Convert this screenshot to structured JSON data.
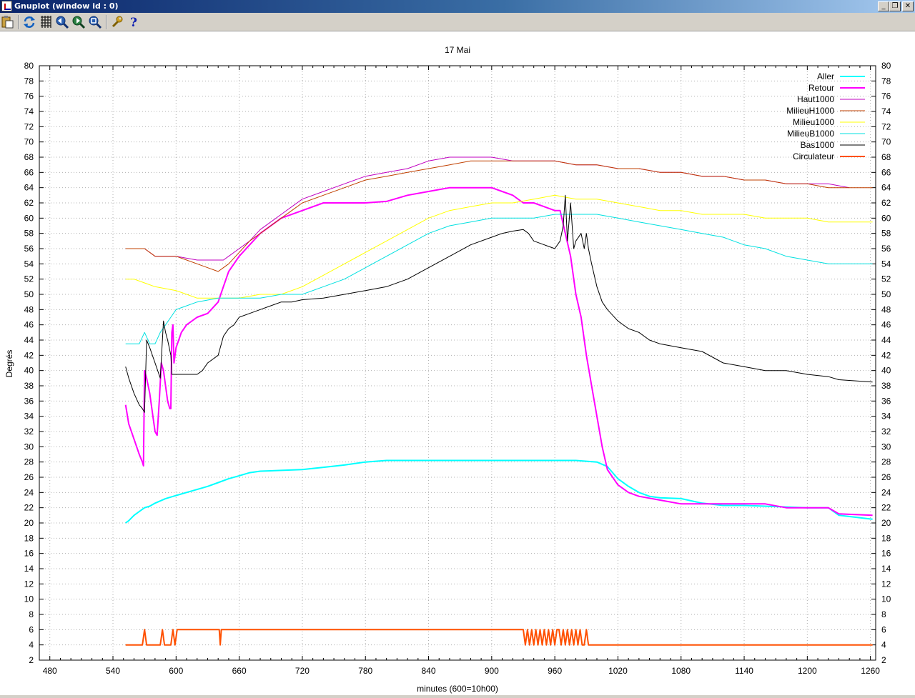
{
  "window": {
    "title": "Gnuplot (window id : 0)"
  },
  "toolbar": {
    "items": [
      "copy-to-clipboard",
      "replot",
      "toggle-grid",
      "zoom-previous",
      "zoom-next",
      "unzoom",
      "options",
      "help"
    ]
  },
  "colors": {
    "Aller": "#00ffff",
    "Retour": "#ff00ff",
    "Haut1000": "#c000c0",
    "MilieuH1000": "#c04000",
    "Milieu1000": "#ffff00",
    "MilieuB1000": "#00e0e0",
    "Bas1000": "#000000",
    "Circulateur": "#ff5000"
  },
  "chart_data": {
    "type": "line",
    "title": "17 Mai",
    "xlabel": "minutes (600=10h00)",
    "ylabel": "Degrés",
    "xlim": [
      470,
      1265
    ],
    "ylim": [
      2,
      80
    ],
    "xticks": [
      480,
      540,
      600,
      660,
      720,
      780,
      840,
      900,
      960,
      1020,
      1080,
      1140,
      1200,
      1260
    ],
    "yticks": [
      2,
      4,
      6,
      8,
      10,
      12,
      14,
      16,
      18,
      20,
      22,
      24,
      26,
      28,
      30,
      32,
      34,
      36,
      38,
      40,
      42,
      44,
      46,
      48,
      50,
      52,
      54,
      56,
      58,
      60,
      62,
      64,
      66,
      68,
      70,
      72,
      74,
      76,
      78,
      80
    ],
    "grid": true,
    "legend_position": "top-right",
    "series": [
      {
        "name": "Aller",
        "color": "#00ffff",
        "width": 2,
        "x": [
          552,
          555,
          560,
          565,
          570,
          575,
          580,
          590,
          600,
          610,
          620,
          630,
          640,
          650,
          660,
          670,
          680,
          700,
          720,
          740,
          760,
          780,
          800,
          820,
          840,
          860,
          880,
          900,
          920,
          940,
          960,
          980,
          1000,
          1010,
          1020,
          1030,
          1040,
          1050,
          1060,
          1080,
          1100,
          1120,
          1140,
          1160,
          1180,
          1200,
          1220,
          1230,
          1262
        ],
        "y": [
          20,
          20.3,
          21,
          21.5,
          22,
          22.2,
          22.6,
          23.2,
          23.6,
          24,
          24.4,
          24.8,
          25.3,
          25.8,
          26.2,
          26.6,
          26.8,
          26.9,
          27,
          27.3,
          27.6,
          28,
          28.2,
          28.2,
          28.2,
          28.2,
          28.2,
          28.2,
          28.2,
          28.2,
          28.2,
          28.2,
          28,
          27.4,
          25.8,
          24.8,
          24,
          23.5,
          23.3,
          23.2,
          22.6,
          22.3,
          22.3,
          22.2,
          22.1,
          22,
          22,
          21,
          20.5
        ]
      },
      {
        "name": "Retour",
        "color": "#ff00ff",
        "width": 2,
        "x": [
          552,
          555,
          560,
          565,
          568,
          569,
          570,
          572,
          575,
          578,
          580,
          582,
          584,
          586,
          588,
          590,
          592,
          594,
          595,
          596,
          597,
          598,
          600,
          605,
          610,
          620,
          630,
          640,
          645,
          650,
          660,
          670,
          680,
          700,
          720,
          740,
          760,
          780,
          800,
          820,
          840,
          860,
          880,
          900,
          910,
          920,
          930,
          940,
          950,
          960,
          965,
          970,
          975,
          980,
          985,
          990,
          995,
          1000,
          1005,
          1010,
          1020,
          1030,
          1040,
          1060,
          1080,
          1100,
          1120,
          1140,
          1160,
          1180,
          1200,
          1220,
          1230,
          1262
        ],
        "y": [
          35.5,
          33,
          31,
          29,
          28,
          27.5,
          40,
          39,
          37,
          34,
          32,
          31.5,
          36,
          41,
          40,
          38,
          36,
          35,
          35,
          45,
          46,
          41,
          43,
          45,
          46,
          47,
          47.5,
          49,
          51,
          53,
          55,
          56.5,
          58,
          60,
          61,
          62,
          62,
          62,
          62.2,
          63,
          63.5,
          64,
          64,
          64,
          63.5,
          63,
          62,
          62,
          61.5,
          61,
          61,
          58,
          55,
          50,
          47,
          42,
          38,
          34,
          30,
          27,
          25,
          24,
          23.5,
          23,
          22.5,
          22.5,
          22.5,
          22.5,
          22.5,
          22,
          22,
          22,
          21.2,
          21
        ]
      },
      {
        "name": "Haut1000",
        "color": "#c000c0",
        "width": 1,
        "x": [
          552,
          570,
          580,
          600,
          620,
          640,
          645,
          650,
          660,
          670,
          680,
          690,
          700,
          710,
          720,
          740,
          760,
          780,
          800,
          820,
          840,
          860,
          880,
          900,
          920,
          940,
          960,
          980,
          1000,
          1020,
          1040,
          1060,
          1080,
          1100,
          1120,
          1140,
          1160,
          1180,
          1200,
          1220,
          1240
        ],
        "y": [
          56,
          56,
          55,
          55,
          54.5,
          54.5,
          54.5,
          55,
          56,
          57,
          58.5,
          59.5,
          60.5,
          61.5,
          62.5,
          63.5,
          64.5,
          65.5,
          66,
          66.5,
          67.5,
          68,
          68,
          68,
          67.5,
          67.5,
          67.5,
          67,
          67,
          66.5,
          66.5,
          66,
          66,
          65.5,
          65.5,
          65,
          65,
          64.5,
          64.5,
          64.5,
          64
        ]
      },
      {
        "name": "MilieuH1000",
        "color": "#c04000",
        "width": 1,
        "x": [
          552,
          570,
          580,
          600,
          620,
          630,
          640,
          645,
          650,
          660,
          670,
          680,
          690,
          700,
          710,
          720,
          740,
          760,
          780,
          800,
          820,
          840,
          860,
          880,
          900,
          920,
          940,
          960,
          980,
          1000,
          1020,
          1040,
          1060,
          1080,
          1100,
          1120,
          1140,
          1160,
          1180,
          1200,
          1220,
          1262
        ],
        "y": [
          56,
          56,
          55,
          55,
          54,
          53.5,
          53,
          53.5,
          54,
          55.5,
          57,
          58,
          59,
          60,
          61,
          62,
          63,
          64,
          65,
          65.5,
          66,
          66.5,
          67,
          67.5,
          67.5,
          67.5,
          67.5,
          67.5,
          67,
          67,
          66.5,
          66.5,
          66,
          66,
          65.5,
          65.5,
          65,
          65,
          64.5,
          64.5,
          64,
          64
        ]
      },
      {
        "name": "Milieu1000",
        "color": "#ffff00",
        "width": 1,
        "x": [
          552,
          560,
          570,
          580,
          600,
          620,
          640,
          660,
          680,
          700,
          720,
          740,
          760,
          780,
          800,
          820,
          840,
          860,
          880,
          900,
          920,
          940,
          960,
          980,
          1000,
          1020,
          1040,
          1060,
          1080,
          1100,
          1120,
          1140,
          1160,
          1180,
          1200,
          1220,
          1262
        ],
        "y": [
          52,
          52,
          51.5,
          51,
          50.5,
          49.5,
          49.5,
          49.5,
          50,
          50,
          51,
          52.5,
          54,
          55.5,
          57,
          58.5,
          60,
          61,
          61.5,
          62,
          62,
          62.5,
          63,
          62.5,
          62.5,
          62,
          61.5,
          61,
          61,
          60.5,
          60.5,
          60.5,
          60,
          60,
          60,
          59.5,
          59.5
        ]
      },
      {
        "name": "MilieuB1000",
        "color": "#00e0e0",
        "width": 1,
        "x": [
          552,
          560,
          565,
          570,
          575,
          580,
          585,
          590,
          595,
          600,
          620,
          640,
          660,
          680,
          700,
          720,
          740,
          760,
          780,
          800,
          820,
          840,
          860,
          880,
          900,
          920,
          940,
          960,
          980,
          1000,
          1020,
          1040,
          1060,
          1080,
          1100,
          1120,
          1140,
          1160,
          1180,
          1200,
          1220,
          1262
        ],
        "y": [
          43.5,
          43.5,
          43.5,
          45,
          43.5,
          43.5,
          45,
          46,
          47,
          48,
          49,
          49.5,
          49.5,
          49.5,
          50,
          50,
          51,
          52,
          53.5,
          55,
          56.5,
          58,
          59,
          59.5,
          60,
          60,
          60,
          60.5,
          60.5,
          60.5,
          60,
          59.5,
          59,
          58.5,
          58,
          57.5,
          56.5,
          56,
          55,
          54.5,
          54,
          54
        ]
      },
      {
        "name": "Bas1000",
        "color": "#000000",
        "width": 1,
        "x": [
          552,
          555,
          560,
          565,
          568,
          570,
          572,
          575,
          580,
          585,
          588,
          590,
          592,
          595,
          596,
          600,
          610,
          620,
          625,
          630,
          640,
          642,
          645,
          650,
          655,
          660,
          670,
          680,
          690,
          700,
          710,
          720,
          740,
          760,
          780,
          800,
          820,
          840,
          860,
          880,
          900,
          910,
          920,
          930,
          935,
          940,
          950,
          960,
          965,
          968,
          970,
          972,
          975,
          978,
          980,
          985,
          988,
          990,
          992,
          995,
          1000,
          1005,
          1010,
          1020,
          1030,
          1040,
          1050,
          1060,
          1080,
          1100,
          1120,
          1140,
          1160,
          1180,
          1200,
          1220,
          1230,
          1262
        ],
        "y": [
          40.5,
          39,
          37,
          35.5,
          35,
          34.5,
          44,
          43,
          41,
          39,
          46.5,
          45,
          44,
          42,
          39.5,
          39.5,
          39.5,
          39.5,
          40,
          41,
          42,
          43,
          44.5,
          45.5,
          46,
          47,
          47.5,
          48,
          48.5,
          49,
          49,
          49.3,
          49.5,
          50,
          50.5,
          51,
          52,
          53.5,
          55,
          56.5,
          57.5,
          58,
          58.3,
          58.5,
          58,
          57,
          56.5,
          56,
          57,
          59,
          63,
          57,
          62,
          56,
          57,
          58,
          56,
          58,
          56,
          54,
          51,
          49,
          48,
          46.5,
          45.5,
          45,
          44,
          43.5,
          43,
          42.5,
          41,
          40.5,
          40,
          40,
          39.5,
          39.2,
          38.8,
          38.5
        ]
      },
      {
        "name": "Circulateur",
        "color": "#ff5000",
        "width": 2,
        "x": [
          552,
          568,
          570,
          572,
          574,
          585,
          587,
          589,
          595,
          597,
          599,
          601,
          641,
          642,
          643,
          930,
          932,
          934,
          936,
          938,
          940,
          942,
          944,
          946,
          948,
          950,
          952,
          954,
          956,
          958,
          960,
          962,
          964,
          966,
          968,
          970,
          972,
          974,
          976,
          978,
          980,
          982,
          984,
          986,
          988,
          990,
          992,
          1262
        ],
        "y": [
          4,
          4,
          6,
          4,
          4,
          4,
          6,
          4,
          4,
          6,
          4,
          6,
          6,
          4,
          6,
          6,
          4,
          6,
          4,
          6,
          4,
          6,
          4,
          6,
          4,
          6,
          4,
          6,
          4,
          6,
          4,
          6,
          6,
          4,
          6,
          4,
          6,
          4,
          6,
          4,
          6,
          4,
          6,
          4,
          4,
          6,
          4,
          4
        ]
      }
    ]
  }
}
